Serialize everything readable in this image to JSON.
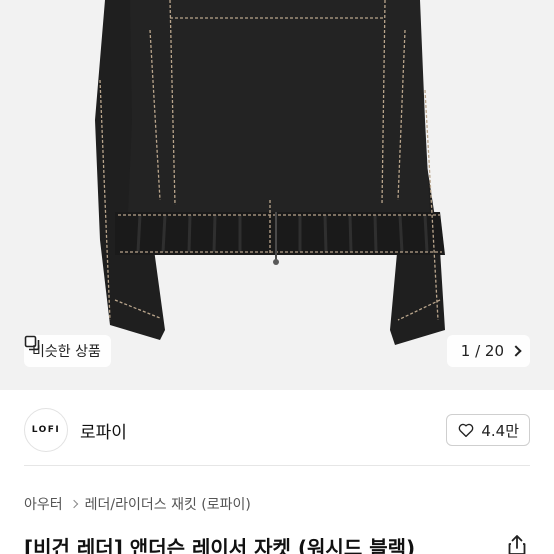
{
  "hero": {
    "image": "black-leather-jacket-photo",
    "similar_button_label": "비슷한 상품",
    "similar_icon": "similar-items-icon",
    "counter_text": "1 / 20"
  },
  "seller": {
    "logo_text": "LOFI",
    "name": "로파이",
    "like_count": "4.4만",
    "like_icon": "heart-icon"
  },
  "breadcrumb": {
    "items": [
      "아우터",
      "레더/라이더스 재킷 (로파이)"
    ]
  },
  "product": {
    "title": "[비건 레더] 앤더슨 레이서 자켓 (워시드 블랙)",
    "share_icon": "share-icon"
  },
  "colors": {
    "jacket": "#1e1e1e",
    "stitch": "#b9a58c",
    "background": "#f2f2f2"
  }
}
